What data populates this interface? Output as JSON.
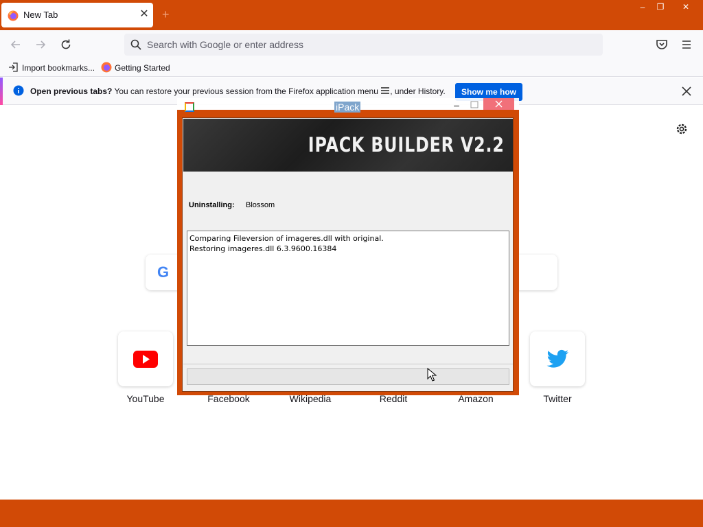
{
  "browser": {
    "tab": {
      "title": "New Tab",
      "close_label": "✕",
      "new_tab_label": "+"
    },
    "window_controls": {
      "minimize": "–",
      "maximize": "❐",
      "close": "✕"
    },
    "urlbar": {
      "placeholder": "Search with Google or enter address"
    },
    "bookmarks": [
      {
        "label": "Import bookmarks...",
        "icon": "import-icon"
      },
      {
        "label": "Getting Started",
        "icon": "firefox-icon"
      }
    ],
    "notification": {
      "bold": "Open previous tabs?",
      "text": " You can restore your previous session from the Firefox application menu ",
      "text_after": ", under History.",
      "button": "Show me how"
    }
  },
  "newtab": {
    "search_icon_letter": "G",
    "top_sites": [
      {
        "label": "YouTube",
        "icon": "youtube-icon"
      },
      {
        "label": "Facebook",
        "icon": "facebook-icon"
      },
      {
        "label": "Wikipedia",
        "icon": "wikipedia-icon"
      },
      {
        "label": "Reddit",
        "icon": "reddit-icon"
      },
      {
        "label": "Amazon",
        "icon": "amazon-icon"
      },
      {
        "label": "Twitter",
        "icon": "twitter-icon"
      }
    ]
  },
  "dialog": {
    "title": "iPack",
    "minimize": "–",
    "banner": "IPACK BUILDER V2.2",
    "uninstalling_label": "Uninstalling:",
    "uninstalling_value": "Blossom",
    "log_lines": [
      "Comparing Fileversion of imageres.dll with original.",
      "Restoring imageres.dll 6.3.9600.16384"
    ],
    "progress": 0
  },
  "colors": {
    "accent": "#d14a06",
    "button_blue": "#0061e0",
    "youtube_red": "#ff0000",
    "twitter_blue": "#1da1f2"
  }
}
